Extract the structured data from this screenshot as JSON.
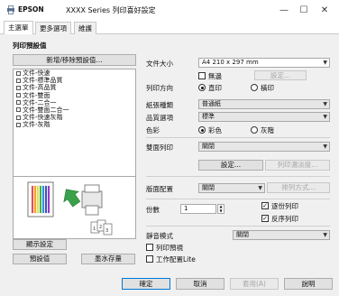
{
  "window": {
    "brand": "EPSON",
    "title": "XXXX Series 列印喜好設定",
    "minimize": "—",
    "maximize": "☐",
    "close": "✕"
  },
  "tabs": [
    "主選單",
    "更多選項",
    "維護"
  ],
  "presets": {
    "heading": "列印預設值",
    "add_remove_button": "新增/移除預設值...",
    "items": [
      "文件-快速",
      "文件-標準品質",
      "文件-高品質",
      "文件-雙面",
      "文件-二合一",
      "文件-雙面二合一",
      "文件-快速灰階",
      "文件-灰階"
    ]
  },
  "buttons": {
    "show_settings": "顯示設定",
    "defaults": "預設值",
    "ink_levels": "墨水存量"
  },
  "settings": {
    "paper_size_label": "文件大小",
    "paper_size_value": "A4 210 x 297 mm",
    "borderless_label": "無邊",
    "borderless_settings_button": "設定...",
    "orientation_label": "列印方向",
    "orientation_portrait": "直印",
    "orientation_landscape": "橫印",
    "paper_type_label": "紙張種類",
    "paper_type_value": "普通紙",
    "quality_label": "品質選項",
    "quality_value": "標準",
    "color_label": "色彩",
    "color_color": "彩色",
    "color_grayscale": "灰階",
    "duplex_label": "雙面列印",
    "duplex_value": "關閉",
    "duplex_settings_button": "設定...",
    "print_density_button": "列印濃淡度...",
    "multipage_label": "版面配置",
    "multipage_value": "關閉",
    "page_order_button": "排列方式...",
    "copies_label": "份數",
    "copies_value": "1",
    "collate_label": "逐份列印",
    "reverse_order_label": "反序列印",
    "quiet_mode_label": "靜音模式",
    "quiet_mode_value": "關閉",
    "print_preview_label": "列印預視",
    "job_arranger_label": "工作配置Lite"
  },
  "footer": {
    "ok": "確定",
    "cancel": "取消",
    "apply": "套用(A)",
    "help": "說明"
  }
}
